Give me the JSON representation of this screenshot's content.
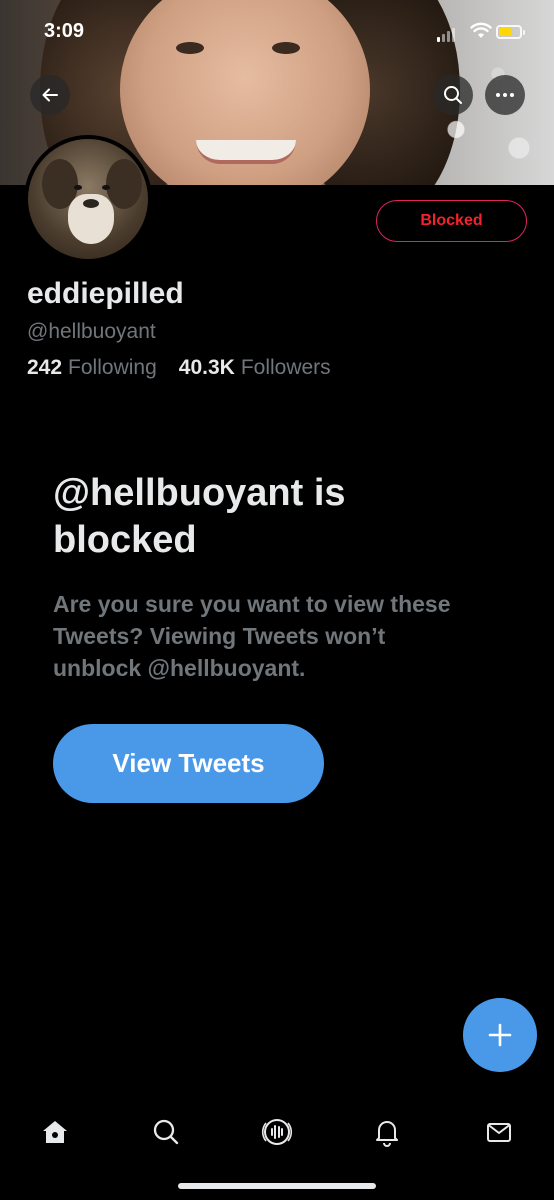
{
  "status_bar": {
    "time": "3:09"
  },
  "profile": {
    "display_name": "eddiepilled",
    "handle": "@hellbuoyant",
    "following_count": "242",
    "following_label": "Following",
    "followers_count": "40.3K",
    "followers_label": "Followers",
    "blocked_label": "Blocked"
  },
  "blocked_notice": {
    "title": "@hellbuoyant is blocked",
    "description": "Are you sure you want to view these Tweets? Viewing Tweets won’t unblock @hellbuoyant.",
    "view_button": "View Tweets"
  },
  "icons": {
    "back": "arrow-left-icon",
    "search": "search-icon",
    "more": "more-icon",
    "compose": "plus-icon",
    "tabs": [
      "home-icon",
      "search-icon",
      "spaces-icon",
      "bell-icon",
      "mail-icon"
    ]
  },
  "colors": {
    "accent": "#4a99e9",
    "blocked": "#f4212e",
    "background": "#000000",
    "secondary_text": "#71767b"
  }
}
